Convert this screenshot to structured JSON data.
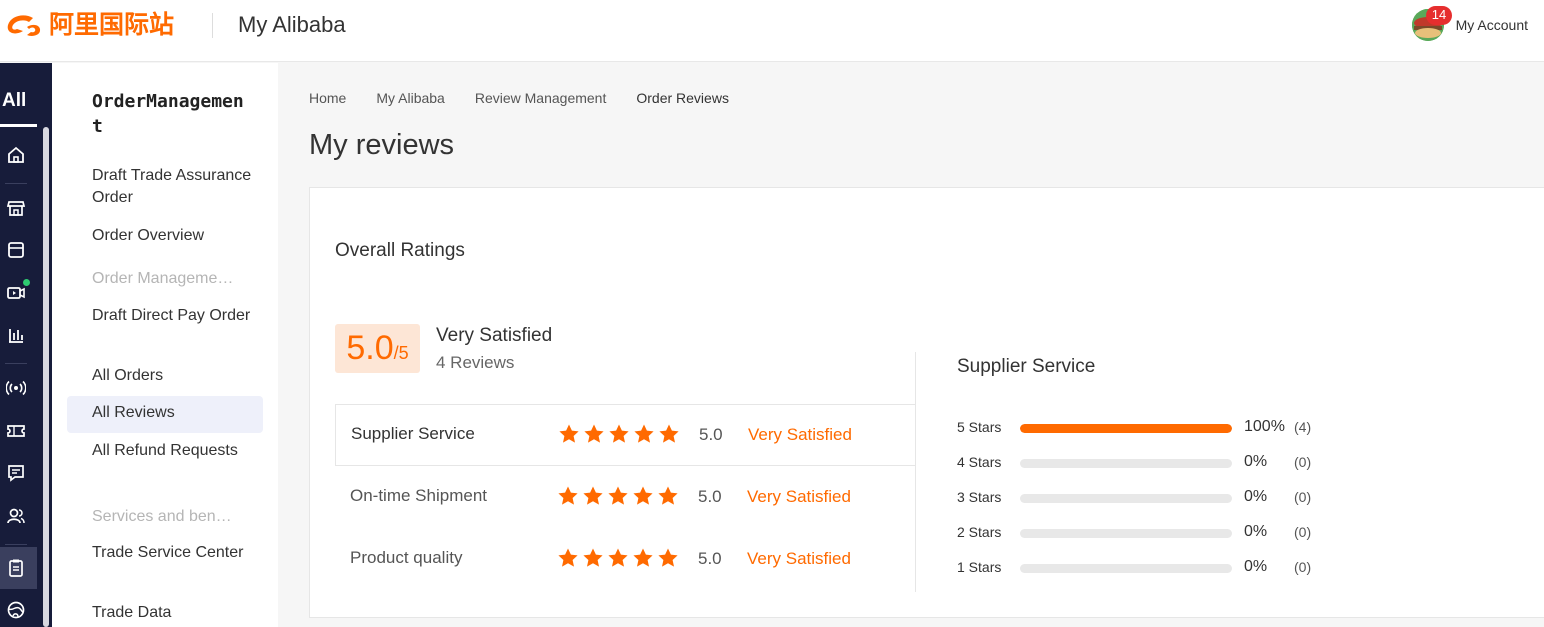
{
  "header": {
    "logo_text": "阿里国际站",
    "app_title": "My Alibaba",
    "notification_count": "14",
    "account_label": "My Account"
  },
  "rail": {
    "all_label": "All",
    "icons": [
      "home-icon",
      "store-icon",
      "box-icon",
      "video-icon",
      "chart-icon",
      "broadcast-icon",
      "ticket-icon",
      "message-icon",
      "users-icon",
      "clipboard-icon",
      "globe-icon"
    ]
  },
  "sidebar": {
    "title": "OrderManagement",
    "items": [
      {
        "label": "Draft Trade Assurance Order"
      },
      {
        "label": "Order Overview"
      },
      {
        "label": "Order Management Tools"
      },
      {
        "label": "Draft Direct Pay Order"
      },
      {
        "label": "All Orders"
      },
      {
        "label": "All Reviews"
      },
      {
        "label": "All Refund Requests"
      },
      {
        "label": "Services and benefits"
      },
      {
        "label": "Trade Service Center"
      },
      {
        "label": "Trade Data"
      }
    ]
  },
  "breadcrumb": [
    "Home",
    "My Alibaba",
    "Review Management",
    "Order Reviews"
  ],
  "page_title": "My reviews",
  "overall": {
    "title": "Overall Ratings",
    "score": "5.0",
    "score_denominator": "/5",
    "satisfaction": "Very Satisfied",
    "review_count": "4 Reviews",
    "categories": [
      {
        "label": "Supplier Service",
        "stars": 5,
        "value": "5.0",
        "text": "Very Satisfied"
      },
      {
        "label": "On-time Shipment",
        "stars": 5,
        "value": "5.0",
        "text": "Very Satisfied"
      },
      {
        "label": "Product quality",
        "stars": 5,
        "value": "5.0",
        "text": "Very Satisfied"
      }
    ]
  },
  "distribution": {
    "title": "Supplier Service",
    "rows": [
      {
        "label": "5  Stars",
        "fraction": 1.0,
        "percent": "100%",
        "count": "(4)"
      },
      {
        "label": "4  Stars",
        "fraction": 0.0,
        "percent": "0%",
        "count": "(0)"
      },
      {
        "label": "3  Stars",
        "fraction": 0.0,
        "percent": "0%",
        "count": "(0)"
      },
      {
        "label": "2  Stars",
        "fraction": 0.0,
        "percent": "0%",
        "count": "(0)"
      },
      {
        "label": "1  Stars",
        "fraction": 0.0,
        "percent": "0%",
        "count": "(0)"
      }
    ]
  },
  "colors": {
    "accent": "#ff6a00",
    "rail_bg": "#171c3a",
    "badge": "#e62e2e",
    "active_item_bg": "#eef0fa"
  }
}
